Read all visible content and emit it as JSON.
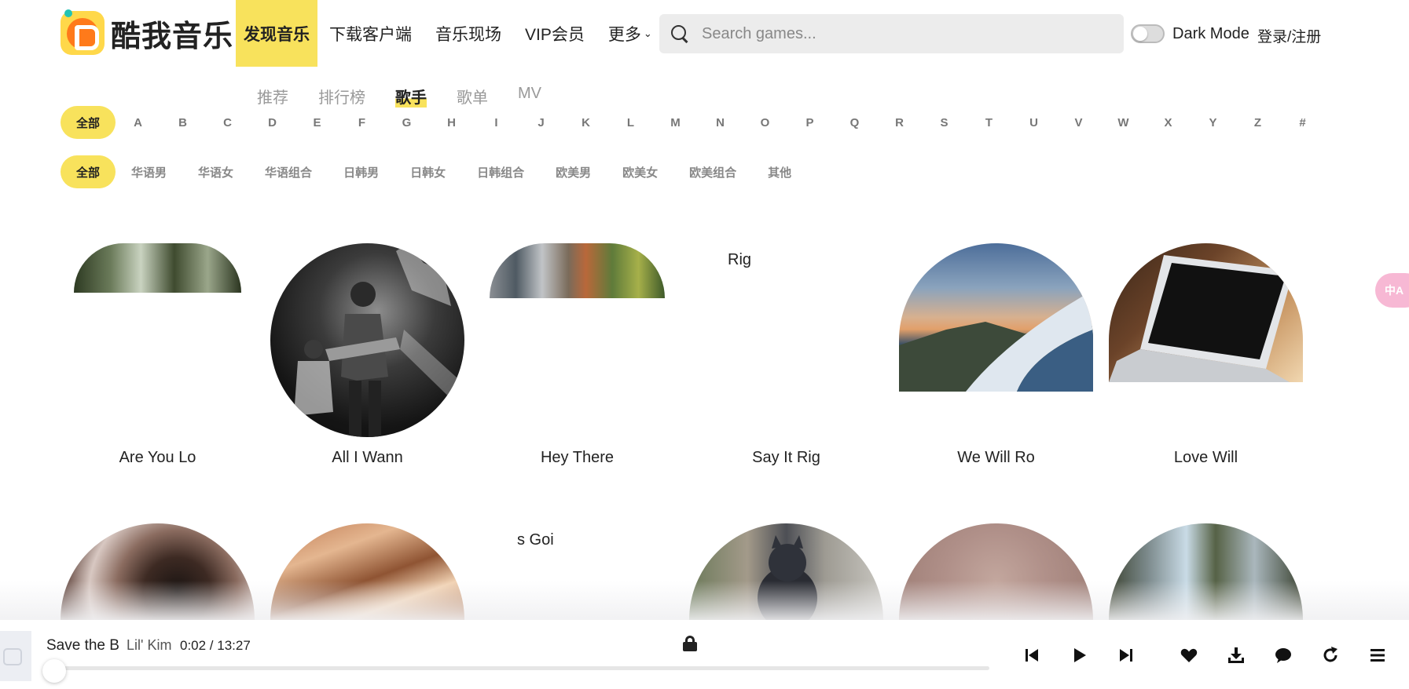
{
  "header": {
    "logo_text": "酷我音乐",
    "nav": [
      {
        "label": "发现音乐",
        "active": true
      },
      {
        "label": "下载客户端"
      },
      {
        "label": "音乐现场"
      },
      {
        "label": "VIP会员"
      },
      {
        "label": "更多",
        "chevron": "⌄"
      }
    ],
    "search_placeholder": "Search games...",
    "dark_mode_label": "Dark Mode",
    "login_label": "登录/注册"
  },
  "subtabs": [
    "推荐",
    "排行榜",
    "歌手",
    "歌单",
    "MV"
  ],
  "subtabs_active": "歌手",
  "letters": [
    "全部",
    "A",
    "B",
    "C",
    "D",
    "E",
    "F",
    "G",
    "H",
    "I",
    "J",
    "K",
    "L",
    "M",
    "N",
    "O",
    "P",
    "Q",
    "R",
    "S",
    "T",
    "U",
    "V",
    "W",
    "X",
    "Y",
    "Z",
    "#"
  ],
  "categories": [
    "全部",
    "华语男",
    "华语女",
    "华语组合",
    "日韩男",
    "日韩女",
    "日韩组合",
    "欧美男",
    "欧美女",
    "欧美组合",
    "其他"
  ],
  "artists": [
    {
      "name": "Are You Lo"
    },
    {
      "name": "All I Wann"
    },
    {
      "name": "Hey There"
    },
    {
      "name": "Say It Rig",
      "broken_image_text": "Rig"
    },
    {
      "name": "We Will Ro"
    },
    {
      "name": "Love Will"
    }
  ],
  "artists_row2": [
    {
      "name": ""
    },
    {
      "name": ""
    },
    {
      "name": "",
      "broken_image_text": "s Goi"
    },
    {
      "name": ""
    },
    {
      "name": ""
    },
    {
      "name": ""
    }
  ],
  "player": {
    "song_title": "Save the B",
    "artist": "Lil' Kim",
    "time": "0:02 / 13:27",
    "progress": 0.0025,
    "icons": [
      "previous-icon",
      "play-icon",
      "next-icon",
      "heart-icon",
      "download-icon",
      "comment-icon",
      "repeat-icon",
      "menu-icon"
    ]
  },
  "translate_fab_label": "中A",
  "colors": {
    "accent": "#f8e25c",
    "logo_orange": "#ff7a1a",
    "logo_yellow": "#ffd84a"
  }
}
